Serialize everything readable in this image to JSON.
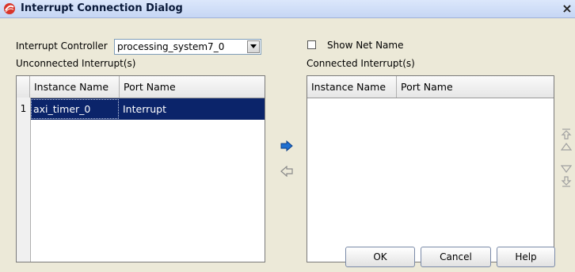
{
  "window": {
    "title": "Interrupt Connection Dialog",
    "close_glyph": "×"
  },
  "controller": {
    "label": "Interrupt Controller",
    "value": "processing_system7_0"
  },
  "show_net_name": {
    "label": "Show Net Name",
    "checked": false
  },
  "unconnected": {
    "label": "Unconnected Interrupt(s)",
    "columns": [
      "Instance Name",
      "Port Name"
    ],
    "rows": [
      {
        "num": "1",
        "instance": "axi_timer_0",
        "port": "Interrupt",
        "selected": true
      }
    ]
  },
  "connected": {
    "label": "Connected Interrupt(s)",
    "columns": [
      "Instance Name",
      "Port Name"
    ],
    "rows": []
  },
  "icons": {
    "connect": "arrow-right-icon",
    "disconnect": "arrow-left-icon",
    "move_top": "move-top-icon",
    "move_up": "move-up-icon",
    "move_down": "move-down-icon",
    "move_bottom": "move-bottom-icon"
  },
  "colors": {
    "selection": "#0b246a",
    "accent_arrow": "#1e6fd0"
  },
  "buttons": {
    "ok": "OK",
    "cancel": "Cancel",
    "help": "Help"
  }
}
